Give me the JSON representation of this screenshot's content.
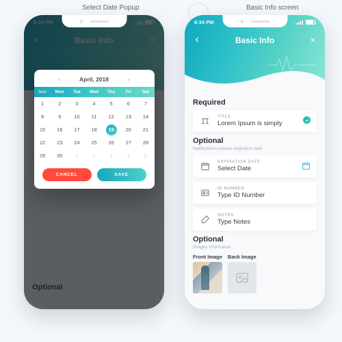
{
  "annotations": {
    "left": "Select Date Popup",
    "right": "Basic Info screen"
  },
  "status": {
    "time": "6:34 PM"
  },
  "header": {
    "title": "Basic Info"
  },
  "right_screen": {
    "required": {
      "heading": "Required"
    },
    "title_card": {
      "label": "TITLE",
      "value": "Lorem Ipsum is simply"
    },
    "optional1": {
      "heading": "Optional",
      "sub": "Notifications require expiration date"
    },
    "exp_card": {
      "label": "EXPIRATION DATE",
      "value": "Select Date"
    },
    "id_card": {
      "label": "ID NUMBER",
      "value": "Type ID Number"
    },
    "notes_card": {
      "label": "NOTES",
      "value": "Type Notes"
    },
    "optional2": {
      "heading": "Optional",
      "sub": "Images Information"
    },
    "front_label": "Front Image",
    "back_label": "Back Image"
  },
  "left_screen": {
    "ghost_optional": "Optional"
  },
  "calendar": {
    "month_label": "April, 2018",
    "dow": [
      "Sun",
      "Mon",
      "Tue",
      "Wed",
      "Thu",
      "Fri",
      "Sat"
    ],
    "days": [
      {
        "n": "1"
      },
      {
        "n": "2"
      },
      {
        "n": "3"
      },
      {
        "n": "4"
      },
      {
        "n": "5"
      },
      {
        "n": "6"
      },
      {
        "n": "7"
      },
      {
        "n": "8"
      },
      {
        "n": "9"
      },
      {
        "n": "10"
      },
      {
        "n": "11"
      },
      {
        "n": "12"
      },
      {
        "n": "13"
      },
      {
        "n": "14"
      },
      {
        "n": "15"
      },
      {
        "n": "16"
      },
      {
        "n": "17"
      },
      {
        "n": "18"
      },
      {
        "n": "19",
        "sel": true
      },
      {
        "n": "20"
      },
      {
        "n": "21"
      },
      {
        "n": "22"
      },
      {
        "n": "23"
      },
      {
        "n": "24"
      },
      {
        "n": "25"
      },
      {
        "n": "26"
      },
      {
        "n": "27"
      },
      {
        "n": "28"
      },
      {
        "n": "29"
      },
      {
        "n": "30"
      },
      {
        "n": "1",
        "out": true
      },
      {
        "n": "2",
        "out": true
      },
      {
        "n": "3",
        "out": true
      },
      {
        "n": "4",
        "out": true
      },
      {
        "n": "5",
        "out": true
      }
    ],
    "cancel": "CANCEL",
    "save": "SAVE"
  }
}
